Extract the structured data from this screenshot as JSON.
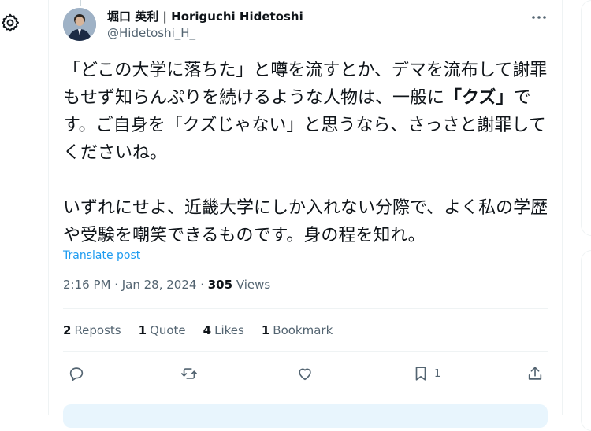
{
  "tweet": {
    "author": {
      "name": "堀口 英利 | Horiguchi Hidetoshi",
      "handle": "@Hidetoshi_H_"
    },
    "body": {
      "para1_part1": "「どこの大学に落ちた」と噂を流すとか、デマを流布して謝罪もせず知らんぷりを続けるような人物は、一般に",
      "para1_bold": "「クズ」",
      "para1_part2": "です。ご自身を「クズじゃない」と思うなら、さっさと謝罪してくださいね。",
      "para2": "いずれにせよ、近畿大学にしか入れない分際で、よく私の学歴や受験を嘲笑できるものです。身の程を知れ。"
    },
    "translate_label": "Translate post",
    "timestamp": "2:16 PM · Jan 28, 2024 · ",
    "views_count": "305",
    "views_label": " Views",
    "stats": {
      "reposts_count": "2",
      "reposts_label": "Reposts",
      "quotes_count": "1",
      "quotes_label": "Quote",
      "likes_count": "4",
      "likes_label": "Likes",
      "bookmarks_count": "1",
      "bookmarks_label": "Bookmark"
    },
    "actions": {
      "bookmark_count": "1"
    }
  },
  "icons": [
    "settings-gear-icon",
    "more-icon",
    "reply-icon",
    "repost-icon",
    "like-icon",
    "bookmark-icon",
    "share-icon"
  ],
  "colors": {
    "link": "#1d9bf0",
    "secondary_text": "#536471",
    "primary_text": "#0f1419",
    "divider": "#eff3f4"
  }
}
